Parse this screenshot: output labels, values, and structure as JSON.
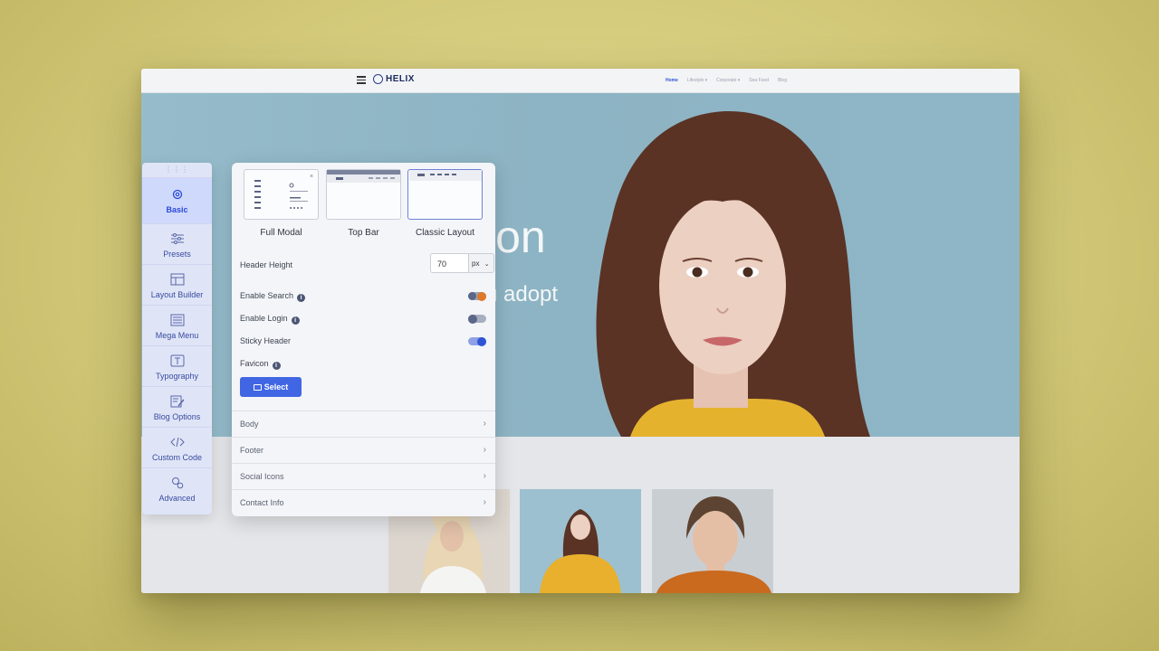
{
  "site": {
    "logo": "HELIX",
    "nav": [
      "Home",
      "Lifestyle ▾",
      "Corporate ▾",
      "Sea Food",
      "Blog"
    ],
    "hero_title": "ion",
    "hero_subtitle": "u adopt"
  },
  "sidebar": {
    "handle": "⋮⋮⋮",
    "items": [
      {
        "label": "Basic",
        "icon": "gear-icon",
        "active": true
      },
      {
        "label": "Presets",
        "icon": "sliders-icon"
      },
      {
        "label": "Layout Builder",
        "icon": "layout-icon"
      },
      {
        "label": "Mega Menu",
        "icon": "menu-grid-icon"
      },
      {
        "label": "Typography",
        "icon": "type-icon"
      },
      {
        "label": "Blog Options",
        "icon": "edit-icon"
      },
      {
        "label": "Custom Code",
        "icon": "code-icon"
      },
      {
        "label": "Advanced",
        "icon": "cogs-icon"
      }
    ]
  },
  "panel": {
    "layouts": [
      {
        "label": "Full Modal"
      },
      {
        "label": "Top Bar"
      },
      {
        "label": "Classic Layout",
        "selected": true
      }
    ],
    "header_height": {
      "label": "Header Height",
      "value": "70",
      "unit": "px"
    },
    "toggles": [
      {
        "label": "Enable Search",
        "info": true,
        "state": "on-orange"
      },
      {
        "label": "Enable Login",
        "info": true,
        "state": "off"
      },
      {
        "label": "Sticky Header",
        "info": false,
        "state": "on"
      }
    ],
    "favicon": {
      "label": "Favicon",
      "button": "Select"
    },
    "accordion": [
      "Body",
      "Footer",
      "Social Icons",
      "Contact Info"
    ]
  },
  "colors": {
    "accent": "#4166e3",
    "toggle_orange": "#e0782a",
    "sidebar_bg": "#dfe5f7"
  }
}
